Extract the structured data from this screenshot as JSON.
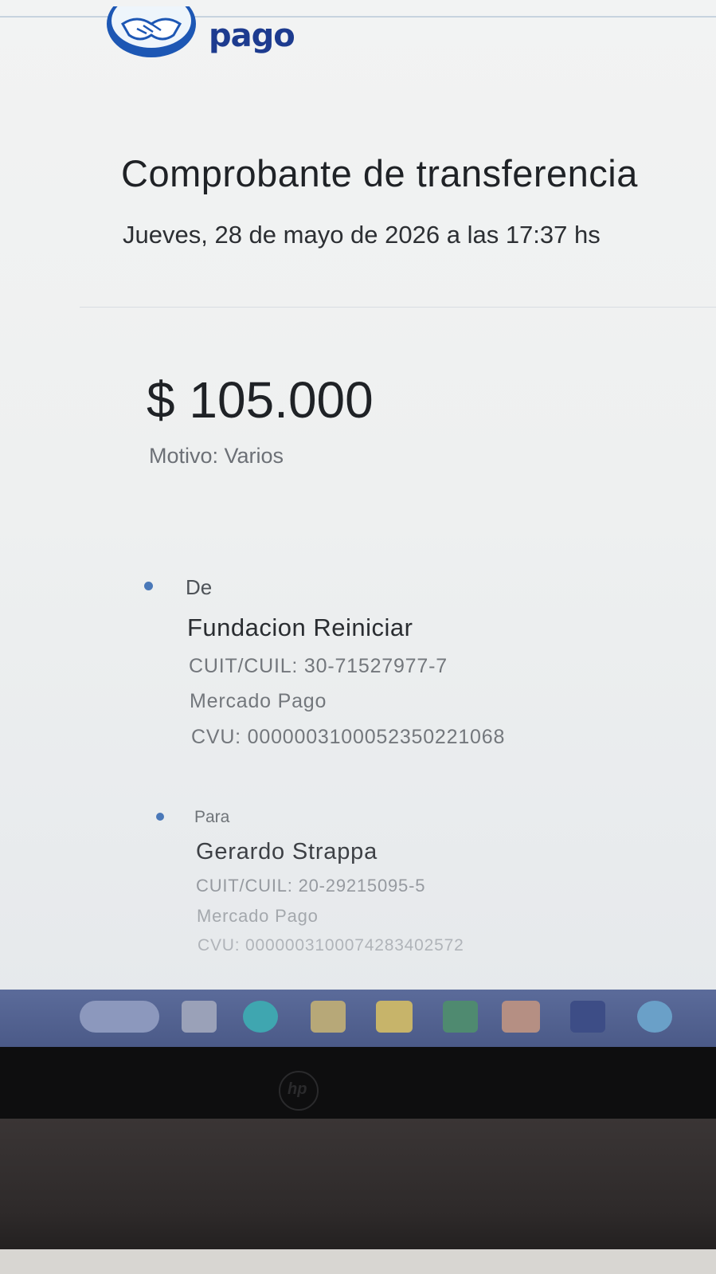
{
  "brand": {
    "logo_text": "pago"
  },
  "receipt": {
    "title": "Comprobante de transferencia",
    "datetime": "Jueves, 28 de mayo de 2026 a las 17:37 hs",
    "amount": "$ 105.000",
    "motive": "Motivo: Varios"
  },
  "from": {
    "role": "De",
    "name": "Fundacion Reiniciar",
    "cuit": "CUIT/CUIL:  30-71527977-7",
    "bank": "Mercado Pago",
    "cvu": "CVU:  0000003100052350221068"
  },
  "to": {
    "role": "Para",
    "name": "Gerardo Strappa",
    "cuit": "CUIT/CUIL:  20-29215095-5",
    "bank": "Mercado Pago",
    "cvu": "CVU:  0000003100074283402572"
  },
  "taskbar": {
    "apps": [
      "search-box",
      "file-icon",
      "edge-icon",
      "store-icon",
      "folder-icon",
      "excel-icon",
      "vpn-icon",
      "photoshop-icon",
      "chrome-icon"
    ]
  },
  "colors": {
    "brand_blue": "#1d3b8f",
    "accent_blue": "#4a78b8",
    "taskbar": "#55649a"
  }
}
